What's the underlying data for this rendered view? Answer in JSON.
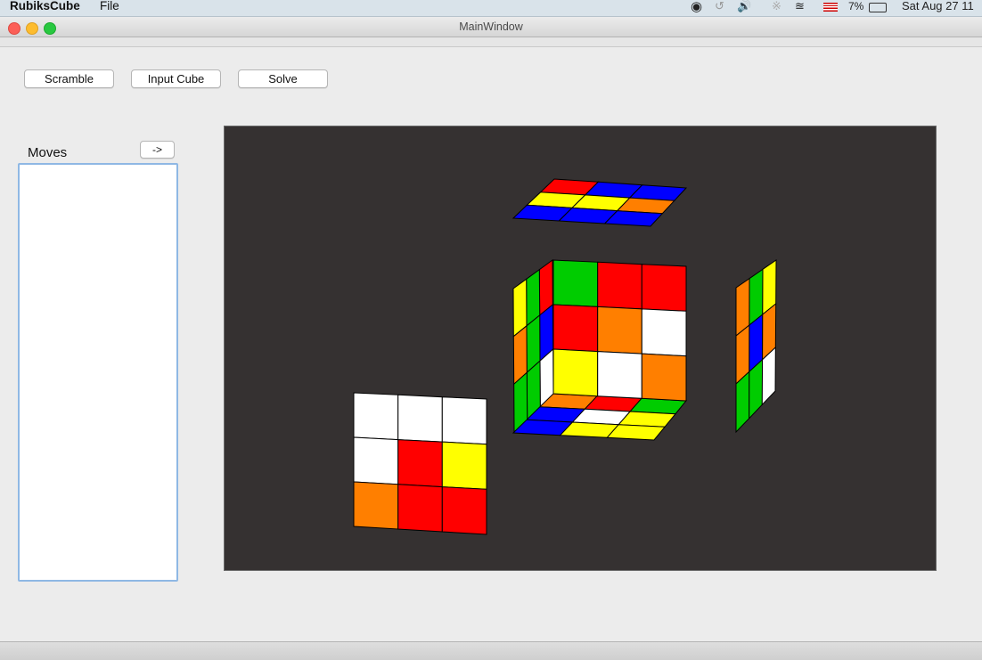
{
  "menubar": {
    "app_name": "RubiksCube",
    "file_menu": "File",
    "battery": "7%",
    "clock": "Sat Aug 27  11"
  },
  "window": {
    "title": "MainWindow"
  },
  "toolbar": {
    "scramble_label": "Scramble",
    "input_cube_label": "Input Cube",
    "solve_label": "Solve"
  },
  "moves_panel": {
    "label": "Moves",
    "next_button_label": "->",
    "items": []
  },
  "cube": {
    "colors": {
      "W": "#ffffff",
      "Y": "#ffff00",
      "R": "#ff0000",
      "O": "#ff7f00",
      "G": "#00cc00",
      "B": "#0000ff"
    },
    "front": [
      [
        "G",
        "R",
        "R"
      ],
      [
        "R",
        "O",
        "W"
      ],
      [
        "Y",
        "W",
        "O"
      ]
    ],
    "left_side": [
      [
        "R",
        "B",
        "W"
      ],
      [
        "G",
        "G",
        "G"
      ],
      [
        "Y",
        "O",
        "G"
      ]
    ],
    "bottom_inner": [
      [
        "O",
        "R",
        "G"
      ],
      [
        "B",
        "W",
        "Y"
      ],
      [
        "B",
        "Y",
        "Y"
      ]
    ],
    "top_floating": [
      [
        "R",
        "B",
        "B"
      ],
      [
        "Y",
        "Y",
        "O"
      ],
      [
        "B",
        "B",
        "B"
      ]
    ],
    "right_floating": [
      [
        "O",
        "G",
        "Y"
      ],
      [
        "O",
        "B",
        "O"
      ],
      [
        "G",
        "G",
        "W"
      ]
    ],
    "back_floating": [
      [
        "W",
        "W",
        "W"
      ],
      [
        "W",
        "R",
        "Y"
      ],
      [
        "O",
        "R",
        "R"
      ]
    ]
  }
}
